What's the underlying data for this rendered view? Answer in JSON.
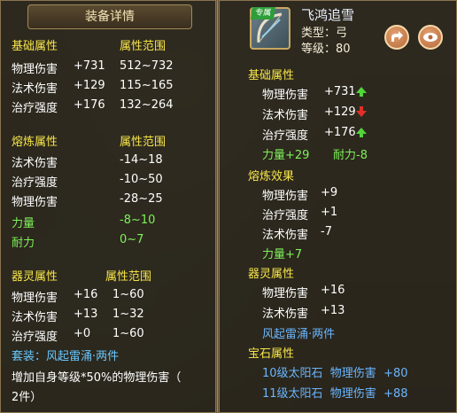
{
  "left": {
    "title": "装备详情",
    "base": {
      "header": "基础属性",
      "range_header": "属性范围",
      "rows": [
        {
          "name": "物理伤害",
          "value": "+731",
          "range": "512~732"
        },
        {
          "name": "法术伤害",
          "value": "+129",
          "range": "115~165"
        },
        {
          "name": "治疗强度",
          "value": "+176",
          "range": "132~264"
        }
      ]
    },
    "refine": {
      "header": "熔炼属性",
      "range_header": "属性范围",
      "rows": [
        {
          "name": "法术伤害",
          "range": "-14~18"
        },
        {
          "name": "治疗强度",
          "range": "-10~50"
        },
        {
          "name": "物理伤害",
          "range": "-28~25"
        },
        {
          "name": "力量",
          "range": "-8~10"
        },
        {
          "name": "耐力",
          "range": "0~7"
        }
      ]
    },
    "spirit": {
      "header": "器灵属性",
      "range_header": "属性范围",
      "rows": [
        {
          "name": "物理伤害",
          "value": "+16",
          "range": "1~60"
        },
        {
          "name": "法术伤害",
          "value": "+13",
          "range": "1~32"
        },
        {
          "name": "治疗强度",
          "value": "+0",
          "range": "1~60"
        }
      ],
      "set_label": "套装：风起雷涌·两件",
      "set_effect": "增加自身等级*50%的物理伤害（",
      "set_effect2": "2件）"
    }
  },
  "right": {
    "item_tag": "专属",
    "item_name": "飞鸿追雪",
    "type_line": "类型：弓",
    "level_line": "等级：80",
    "share_icon": "share-icon",
    "view_icon": "eye-icon",
    "base": {
      "header": "基础属性",
      "rows": [
        {
          "name": "物理伤害",
          "value": "+731",
          "trend": "up"
        },
        {
          "name": "法术伤害",
          "value": "+129",
          "trend": "down"
        },
        {
          "name": "治疗强度",
          "value": "+176",
          "trend": "up"
        }
      ],
      "extra1": "力量+29",
      "extra2": "耐力-8"
    },
    "refine": {
      "header": "熔炼效果",
      "rows": [
        {
          "name": "物理伤害",
          "value": "+9"
        },
        {
          "name": "治疗强度",
          "value": "+1"
        },
        {
          "name": "法术伤害",
          "value": "-7"
        }
      ],
      "extra": "力量+7"
    },
    "spirit": {
      "header": "器灵属性",
      "rows": [
        {
          "name": "物理伤害",
          "value": "+16"
        },
        {
          "name": "法术伤害",
          "value": "+13"
        }
      ],
      "set_label": "风起雷涌·两件"
    },
    "gem": {
      "header": "宝石属性",
      "rows": [
        {
          "text": "10级太阳石  物理伤害  +80"
        },
        {
          "text": "11级太阳石  物理伤害  +88"
        }
      ]
    }
  }
}
